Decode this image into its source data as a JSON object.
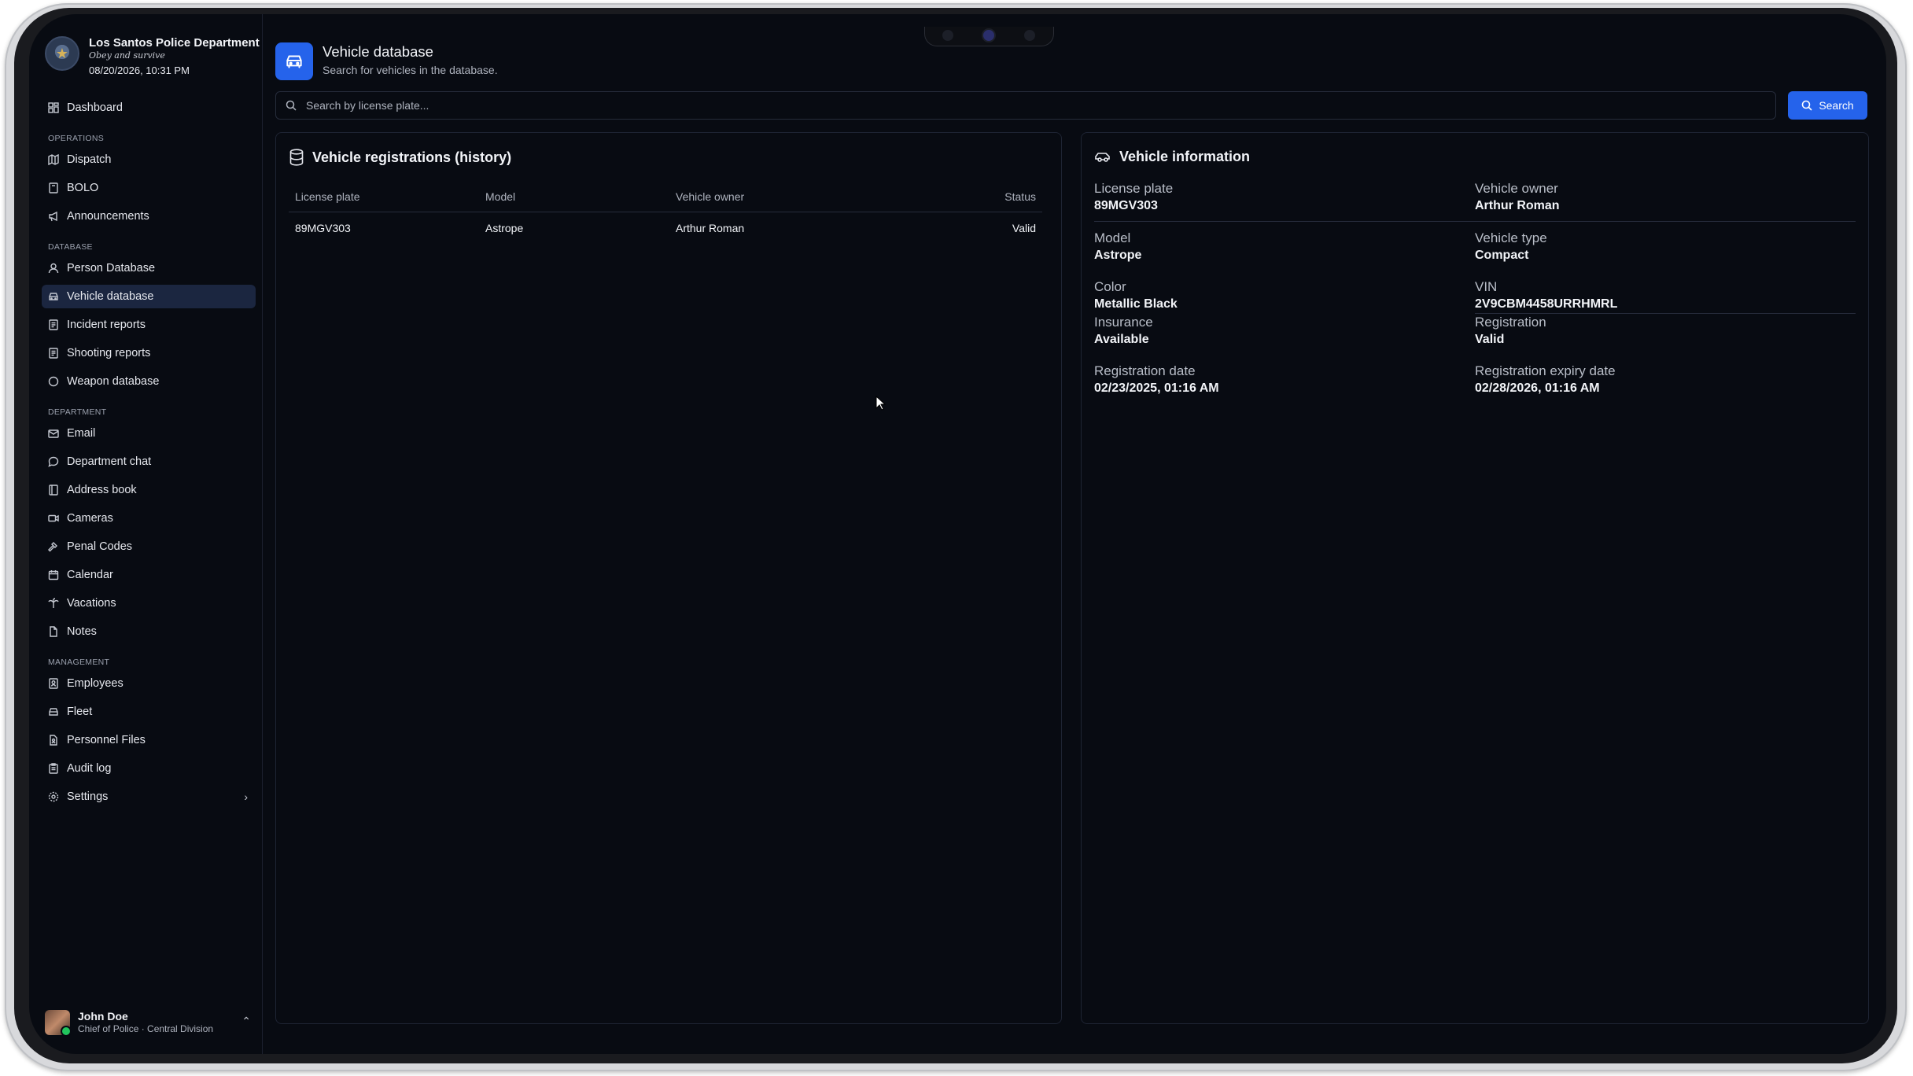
{
  "org": {
    "name": "Los Santos Police Department",
    "motto": "Obey and survive",
    "datetime": "08/20/2026, 10:31 PM"
  },
  "nav": {
    "dashboard": "Dashboard",
    "sections": {
      "operations": "OPERATIONS",
      "database": "DATABASE",
      "department": "DEPARTMENT",
      "management": "MANAGEMENT"
    },
    "operations": [
      "Dispatch",
      "BOLO",
      "Announcements"
    ],
    "database": [
      "Person Database",
      "Vehicle database",
      "Incident reports",
      "Shooting reports",
      "Weapon database"
    ],
    "department": [
      "Email",
      "Department chat",
      "Address book",
      "Cameras",
      "Penal Codes",
      "Calendar",
      "Vacations",
      "Notes"
    ],
    "management": [
      "Employees",
      "Fleet",
      "Personnel Files",
      "Audit log",
      "Settings"
    ]
  },
  "user": {
    "name": "John Doe",
    "role": "Chief of Police · Central Division"
  },
  "header": {
    "title": "Vehicle database",
    "subtitle": "Search for vehicles in the database."
  },
  "search": {
    "placeholder": "Search by license plate...",
    "button": "Search"
  },
  "registrations": {
    "title": "Vehicle registrations (history)",
    "columns": [
      "License plate",
      "Model",
      "Vehicle owner",
      "Status"
    ],
    "rows": [
      [
        "89MGV303",
        "Astrope",
        "Arthur Roman",
        "Valid"
      ]
    ]
  },
  "info": {
    "title": "Vehicle information",
    "license_plate_label": "License plate",
    "license_plate": "89MGV303",
    "owner_label": "Vehicle owner",
    "owner": "Arthur Roman",
    "model_label": "Model",
    "model": "Astrope",
    "type_label": "Vehicle type",
    "type": "Compact",
    "color_label": "Color",
    "color": "Metallic Black",
    "vin_label": "VIN",
    "vin": "2V9CBM4458URRHMRL",
    "insurance_label": "Insurance",
    "insurance": "Available",
    "registration_label": "Registration",
    "registration": "Valid",
    "reg_date_label": "Registration date",
    "reg_date": "02/23/2025, 01:16 AM",
    "reg_expiry_label": "Registration expiry date",
    "reg_expiry": "02/28/2026, 01:16 AM"
  },
  "colors": {
    "accent": "#2563eb",
    "background": "#080b12",
    "active_nav": "#1b2640"
  }
}
